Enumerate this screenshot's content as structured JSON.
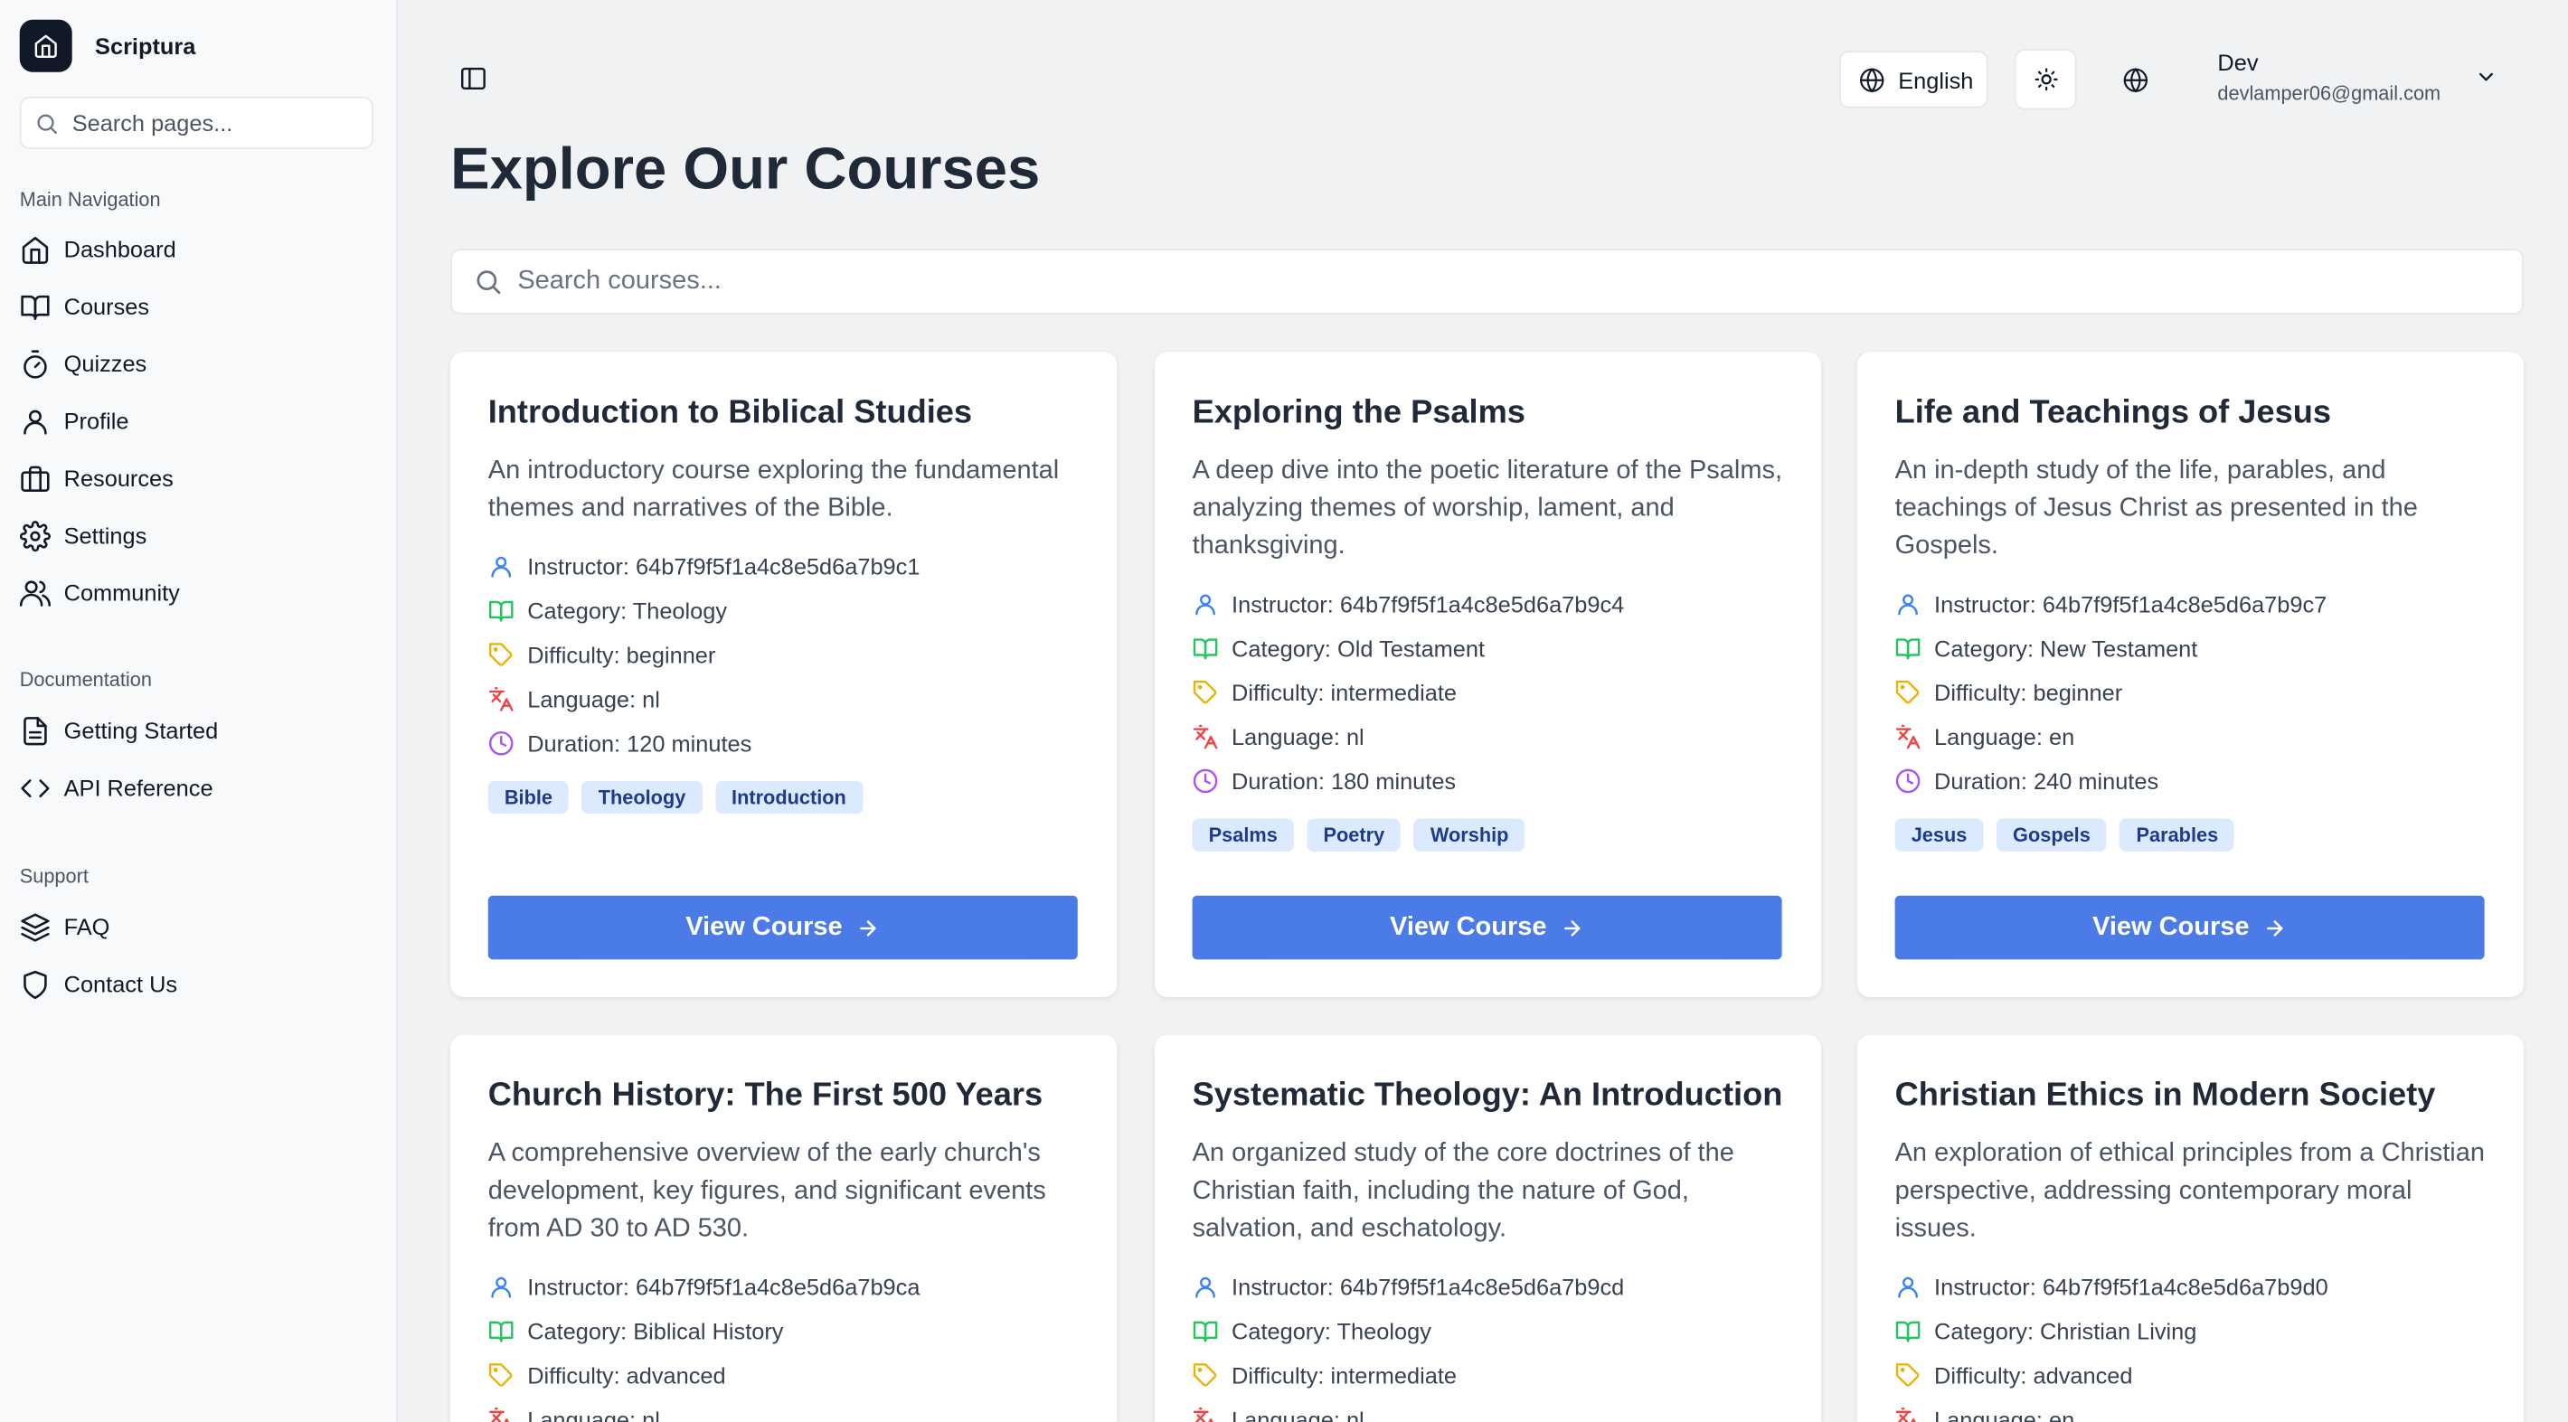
{
  "brand": {
    "name": "Scriptura"
  },
  "sidebar": {
    "search_placeholder": "Search pages...",
    "sections": [
      {
        "title": "Main Navigation",
        "items": [
          {
            "label": "Dashboard",
            "icon": "home-icon"
          },
          {
            "label": "Courses",
            "icon": "book-open-icon"
          },
          {
            "label": "Quizzes",
            "icon": "timer-icon"
          },
          {
            "label": "Profile",
            "icon": "user-icon"
          },
          {
            "label": "Resources",
            "icon": "briefcase-icon"
          },
          {
            "label": "Settings",
            "icon": "gear-icon"
          },
          {
            "label": "Community",
            "icon": "users-icon"
          }
        ]
      },
      {
        "title": "Documentation",
        "items": [
          {
            "label": "Getting Started",
            "icon": "file-text-icon"
          },
          {
            "label": "API Reference",
            "icon": "code-icon"
          }
        ]
      },
      {
        "title": "Support",
        "items": [
          {
            "label": "FAQ",
            "icon": "layers-icon"
          },
          {
            "label": "Contact Us",
            "icon": "shield-icon"
          }
        ]
      }
    ]
  },
  "header": {
    "language_label": "English",
    "user_name": "Dev",
    "user_email": "devlamper06@gmail.com"
  },
  "main": {
    "title": "Explore Our Courses",
    "search_placeholder": "Search courses...",
    "view_button_label": "View Course",
    "courses": [
      {
        "title": "Introduction to Biblical Studies",
        "description": "An introductory course exploring the fundamental themes and narratives of the Bible.",
        "instructor": "Instructor: 64b7f9f5f1a4c8e5d6a7b9c1",
        "category": "Category: Theology",
        "difficulty": "Difficulty: beginner",
        "language": "Language: nl",
        "duration": "Duration: 120 minutes",
        "tags": [
          "Bible",
          "Theology",
          "Introduction"
        ]
      },
      {
        "title": "Exploring the Psalms",
        "description": "A deep dive into the poetic literature of the Psalms, analyzing themes of worship, lament, and thanksgiving.",
        "instructor": "Instructor: 64b7f9f5f1a4c8e5d6a7b9c4",
        "category": "Category: Old Testament",
        "difficulty": "Difficulty: intermediate",
        "language": "Language: nl",
        "duration": "Duration: 180 minutes",
        "tags": [
          "Psalms",
          "Poetry",
          "Worship"
        ]
      },
      {
        "title": "Life and Teachings of Jesus",
        "description": "An in-depth study of the life, parables, and teachings of Jesus Christ as presented in the Gospels.",
        "instructor": "Instructor: 64b7f9f5f1a4c8e5d6a7b9c7",
        "category": "Category: New Testament",
        "difficulty": "Difficulty: beginner",
        "language": "Language: en",
        "duration": "Duration: 240 minutes",
        "tags": [
          "Jesus",
          "Gospels",
          "Parables"
        ]
      },
      {
        "title": "Church History: The First 500 Years",
        "description": "A comprehensive overview of the early church's development, key figures, and significant events from AD 30 to AD 530.",
        "instructor": "Instructor: 64b7f9f5f1a4c8e5d6a7b9ca",
        "category": "Category: Biblical History",
        "difficulty": "Difficulty: advanced",
        "language": "Language: nl"
      },
      {
        "title": "Systematic Theology: An Introduction",
        "description": "An organized study of the core doctrines of the Christian faith, including the nature of God, salvation, and eschatology.",
        "instructor": "Instructor: 64b7f9f5f1a4c8e5d6a7b9cd",
        "category": "Category: Theology",
        "difficulty": "Difficulty: intermediate",
        "language": "Language: nl"
      },
      {
        "title": "Christian Ethics in Modern Society",
        "description": "An exploration of ethical principles from a Christian perspective, addressing contemporary moral issues.",
        "instructor": "Instructor: 64b7f9f5f1a4c8e5d6a7b9d0",
        "category": "Category: Christian Living",
        "difficulty": "Difficulty: advanced",
        "language": "Language: en"
      }
    ]
  },
  "colors": {
    "accent": "#4a7be6",
    "tag_bg": "#dbeafe",
    "tag_text": "#1e3a8a"
  }
}
